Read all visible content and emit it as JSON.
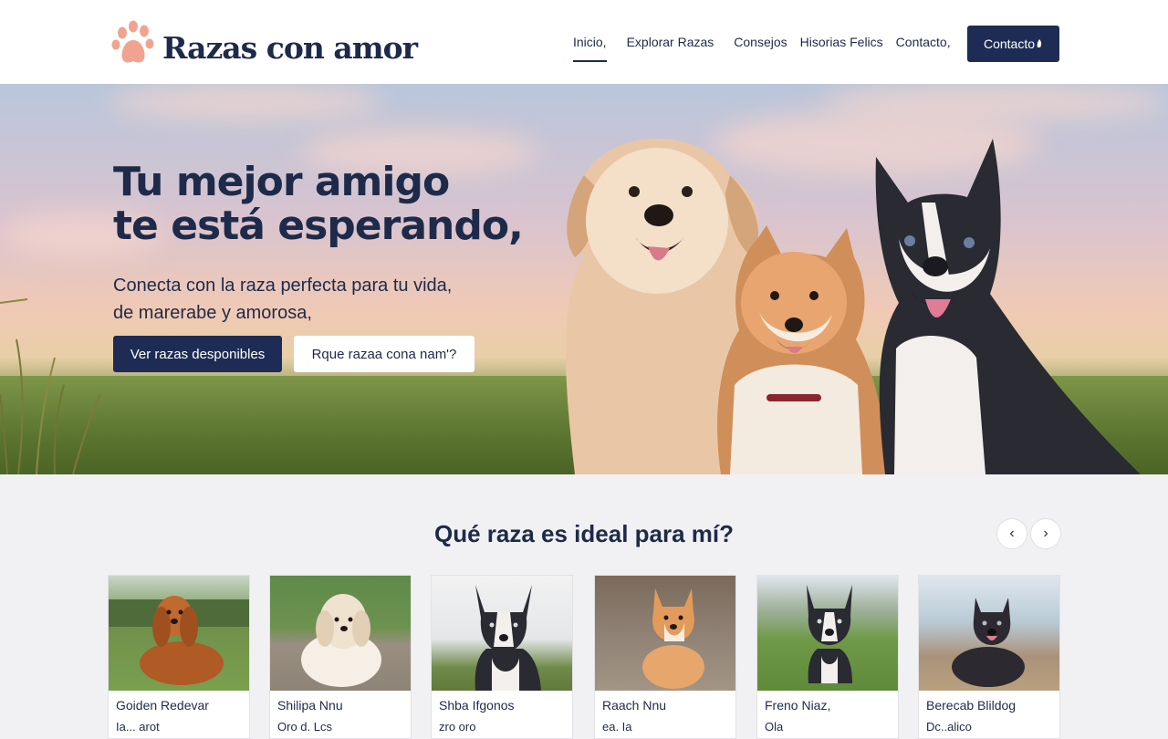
{
  "brand": {
    "name": "Razas con amor",
    "icon": "paw-icon",
    "accent": "#f0a48f"
  },
  "nav": {
    "items": [
      "Inicio,",
      "Explorar Razas",
      "Consejos",
      "Hisorias Felics",
      "Contacto,"
    ],
    "active_index": 0,
    "cta_label": "Contacto"
  },
  "hero": {
    "title_line1": "Tu mejor amigo",
    "title_line2": "te está esperando,",
    "subtitle_line1": "Conecta con la raza perfecta para tu vida,",
    "subtitle_line2": "de marerabe y amorosa,",
    "primary_button": "Ver razas desponibles",
    "secondary_button": "Rque razaa cona nam'?"
  },
  "section": {
    "title": "Qué raza es ideal para mí?",
    "prev_icon": "chevron-left-icon",
    "next_icon": "chevron-right-icon"
  },
  "cards": [
    {
      "name": "Goiden Redevar",
      "meta": "Ia... arot"
    },
    {
      "name": "Shilipa Nnu",
      "meta": "Oro d. Lcs"
    },
    {
      "name": "Shba Ifgonos",
      "meta": "zro oro"
    },
    {
      "name": "Raach Nnu",
      "meta": "ea. Ia"
    },
    {
      "name": "Freno Niaz,",
      "meta": "Ola"
    },
    {
      "name": "Berecab Blildog",
      "meta": "Dc..alico"
    }
  ],
  "colors": {
    "primary": "#1e2c55",
    "text": "#1e2a4a",
    "background": "#f1f1f3"
  }
}
